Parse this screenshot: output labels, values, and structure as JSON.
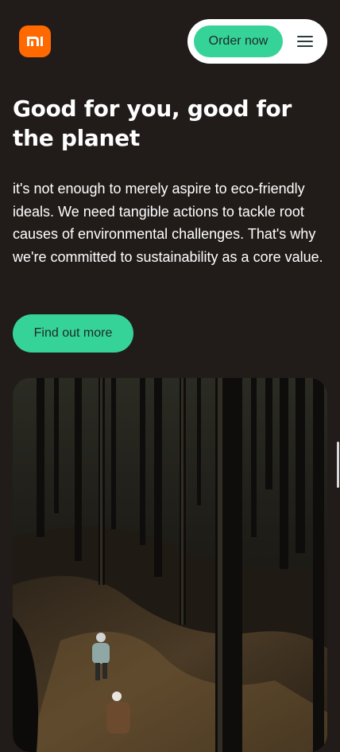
{
  "colors": {
    "background": "#211c1a",
    "accent": "#36d399",
    "brand": "#ff6900",
    "pill": "#ffffff",
    "button_text": "#1e2a26"
  },
  "header": {
    "logo_icon": "mi-logo-icon",
    "order_label": "Order now",
    "menu_icon": "hamburger-menu-icon"
  },
  "hero": {
    "headline": "Good for you, good for the planet",
    "body": "it's not enough to merely aspire to eco-friendly ideals. We need tangible actions to tackle root causes of environmental challenges. That's why we're committed to sustainability as a core value.",
    "cta_label": "Find out more",
    "image_description": "forest-photo"
  }
}
